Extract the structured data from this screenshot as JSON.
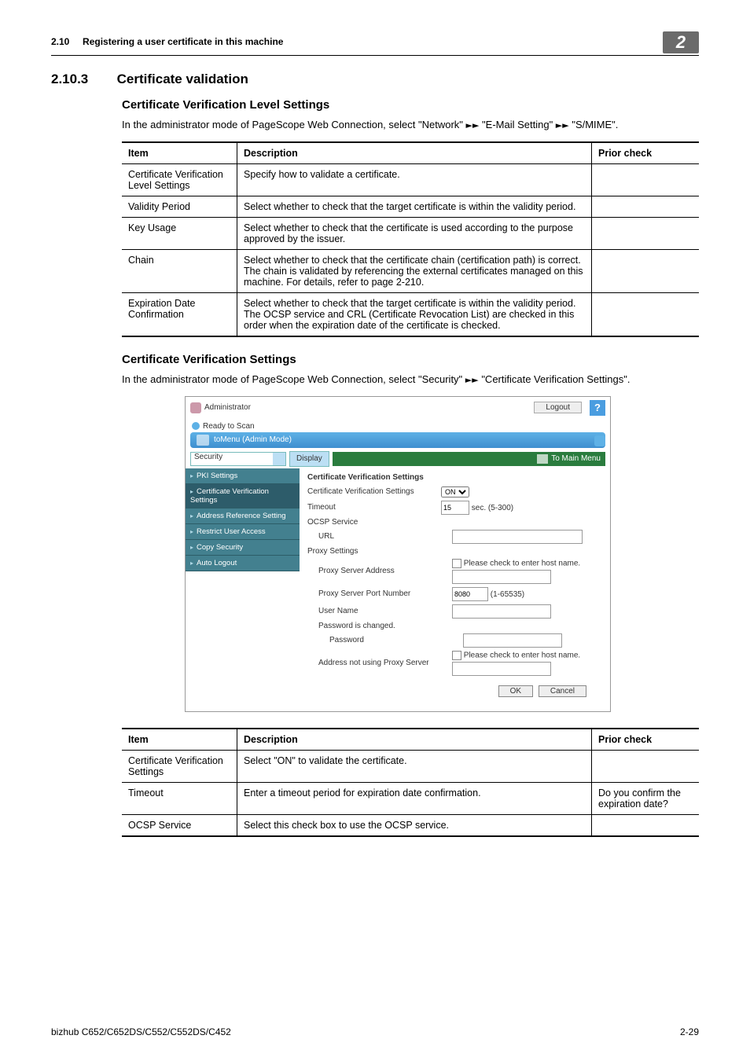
{
  "header": {
    "section": "2.10",
    "title": "Registering a user certificate in this machine",
    "badge": "2"
  },
  "section": {
    "num": "2.10.3",
    "title": "Certificate validation"
  },
  "sub1": {
    "title": "Certificate Verification Level Settings",
    "intro_a": "In the administrator mode of PageScope Web Connection, select \"Network\" ",
    "intro_b": " \"E-Mail Setting\" ",
    "intro_c": " \"S/MIME\".",
    "arrow": "►►",
    "th": {
      "item": "Item",
      "desc": "Description",
      "prior": "Prior check"
    },
    "rows": [
      {
        "item": "Certificate Verification Level Settings",
        "desc": "Specify how to validate a certificate.",
        "prior": ""
      },
      {
        "item": "Validity Period",
        "desc": "Select whether to check that the target certificate is within the validity period.",
        "prior": ""
      },
      {
        "item": "Key Usage",
        "desc": "Select whether to check that the certificate is used according to the purpose approved by the issuer.",
        "prior": ""
      },
      {
        "item": "Chain",
        "desc": "Select whether to check that the certificate chain (certification path) is correct.\nThe chain is validated by referencing the external certificates managed on this machine. For details, refer to page 2-210.",
        "prior": ""
      },
      {
        "item": "Expiration Date Confirmation",
        "desc": "Select whether to check that the target certificate is within the validity period.\nThe OCSP service and CRL (Certificate Revocation List) are checked in this order when the expiration date of the certificate is checked.",
        "prior": ""
      }
    ]
  },
  "sub2": {
    "title": "Certificate Verification Settings",
    "intro_a": "In the administrator mode of PageScope Web Connection, select \"Security\" ",
    "intro_b": " \"Certificate Verification Settings\".",
    "arrow": "►►",
    "th": {
      "item": "Item",
      "desc": "Description",
      "prior": "Prior check"
    },
    "rows": [
      {
        "item": "Certificate Verification Settings",
        "desc": "Select \"ON\" to validate the certificate.",
        "prior": ""
      },
      {
        "item": "Timeout",
        "desc": "Enter a timeout period for expiration date confirmation.",
        "prior": "Do you confirm the expiration date?"
      },
      {
        "item": "OCSP Service",
        "desc": "Select this check box to use the OCSP service.",
        "prior": ""
      }
    ]
  },
  "screenshot": {
    "admin": "Administrator",
    "logout": "Logout",
    "help": "?",
    "ready": "Ready to Scan",
    "banner": "toMenu (Admin Mode)",
    "sec_sel": "Security",
    "display": "Display",
    "tomain": "To Main Menu",
    "side": [
      "PKI Settings",
      "Certificate Verification Settings",
      "Address Reference Setting",
      "Restrict User Access",
      "Copy Security",
      "Auto Logout"
    ],
    "panel_title": "Certificate Verification Settings",
    "rows": {
      "cvs": "Certificate Verification Settings",
      "cvs_v": "ON",
      "timeout": "Timeout",
      "timeout_v": "15",
      "timeout_u": "sec. (5-300)",
      "ocsp": "OCSP Service",
      "url": "URL",
      "proxy": "Proxy Settings",
      "psa": "Proxy Server Address",
      "psa_note": "Please check to enter host name.",
      "pport": "Proxy Server Port Number",
      "pport_v": "8080",
      "pport_u": "(1-65535)",
      "uname": "User Name",
      "pchg": "Password is changed.",
      "pwd": "Password",
      "anot": "Address not using Proxy Server",
      "anot_note": "Please check to enter host name."
    },
    "ok": "OK",
    "cancel": "Cancel"
  },
  "footer": {
    "model": "bizhub C652/C652DS/C552/C552DS/C452",
    "page": "2-29"
  }
}
